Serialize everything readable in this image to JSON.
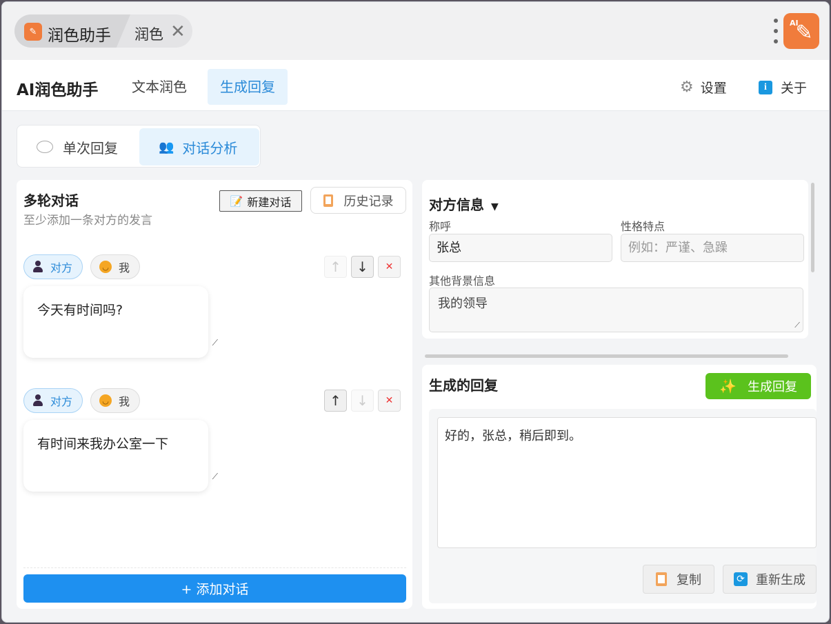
{
  "titlebar": {
    "tab_title": "润色助手",
    "tab_second": "润色",
    "close_glyph": "✕",
    "app_icon_text": "AI"
  },
  "navbar": {
    "brand": "AI润色助手",
    "items": [
      {
        "label": "文本润色"
      },
      {
        "label": "生成回复"
      }
    ],
    "settings": "设置",
    "about": "关于"
  },
  "segment": {
    "single": "单次回复",
    "dialog": "对话分析"
  },
  "dialog": {
    "title": "多轮对话",
    "subtitle": "至少添加一条对方的发言",
    "new_btn": "新建对话",
    "history_btn": "历史记录",
    "other_label": "对方",
    "me_label": "我",
    "messages": [
      {
        "text": "今天有时间吗?"
      },
      {
        "text": "有时间来我办公室一下"
      }
    ],
    "add_btn": "+ 添加对话"
  },
  "info": {
    "title": "对方信息",
    "name_label": "称呼",
    "name_value": "张总",
    "trait_label": "性格特点",
    "trait_placeholder": "例如：严谨、急躁",
    "bg_label": "其他背景信息",
    "bg_value": "我的领导"
  },
  "reply": {
    "title": "生成的回复",
    "gen_btn": "生成回复",
    "text": "好的，张总，稍后即到。",
    "copy_btn": "复制",
    "regen_btn": "重新生成"
  },
  "colors": {
    "accent": "#1e90f0",
    "active_tab_bg": "#e6f3fd",
    "generate": "#5bc21d",
    "app_icon": "#f07c3c"
  }
}
